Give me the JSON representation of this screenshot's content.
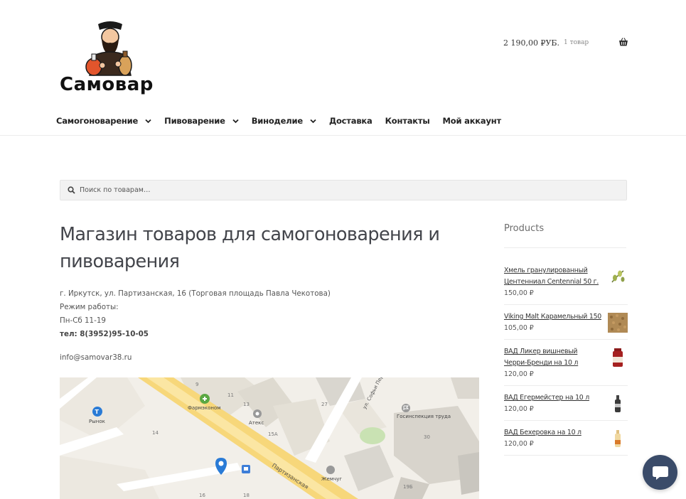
{
  "header": {
    "logo_text": "Самовар",
    "cart": {
      "amount": "2 190,00 ₽УБ.",
      "count": "1 товар"
    }
  },
  "nav": {
    "items": [
      {
        "label": "Самогоноварение",
        "has_dropdown": true
      },
      {
        "label": "Пивоварение",
        "has_dropdown": true
      },
      {
        "label": "Виноделие",
        "has_dropdown": true
      },
      {
        "label": "Доставка",
        "has_dropdown": false
      },
      {
        "label": "Контакты",
        "has_dropdown": false
      },
      {
        "label": "Мой аккаунт",
        "has_dropdown": false
      }
    ]
  },
  "search": {
    "placeholder": "Поиск по товарам…"
  },
  "main": {
    "title": "Магазин товаров для самогоноварения и пивоварения",
    "address": "г. Иркутск, ул. Партизанская, 16 (Торговая площадь Павла Чекотова)",
    "hours_label": "Режим работы:",
    "hours": "Пн-Сб 11-19",
    "phone": "тел: 8(3952)95-10-05",
    "email": "info@samovar38.ru"
  },
  "map": {
    "labels": {
      "pharmacy": "Фармэконом",
      "market": "Рынок",
      "atex": "Атекс",
      "gov": "Госинспекция труда",
      "jemchug": "Жемчуг",
      "street1": "Партизанская",
      "street2": "ул. Софьи Перовской",
      "n9": "9",
      "n11": "11",
      "n13": "13",
      "n14": "14",
      "n15a": "15А",
      "n16": "16",
      "n18": "18",
      "n27": "27",
      "n30": "30",
      "n19b": "19Б"
    }
  },
  "sidebar": {
    "title": "Products",
    "products": [
      {
        "name": "Хмель гранулированный Центенниал Centennial 50 г.",
        "price": "150,00 ₽"
      },
      {
        "name": "Viking Malt Карамельный 150",
        "price": "105,00 ₽"
      },
      {
        "name": "ВАД Ликер вишневый Черри-Бренди на 10 л",
        "price": "120,00 ₽"
      },
      {
        "name": "ВАД Егермейстер на 10 л",
        "price": "120,00 ₽"
      },
      {
        "name": "ВАД Бехеровка на 10 л",
        "price": "120,00 ₽"
      }
    ]
  },
  "colors": {
    "chat_button": "#3a4b69",
    "map_bg": "#f2efe9",
    "road": "#f7d77a",
    "accent_blue": "#2a7bd6"
  },
  "icons": [
    "cart-icon",
    "chevron-down-icon",
    "search-icon",
    "chat-icon",
    "map-pin-icon",
    "pharmacy-icon",
    "market-icon"
  ]
}
